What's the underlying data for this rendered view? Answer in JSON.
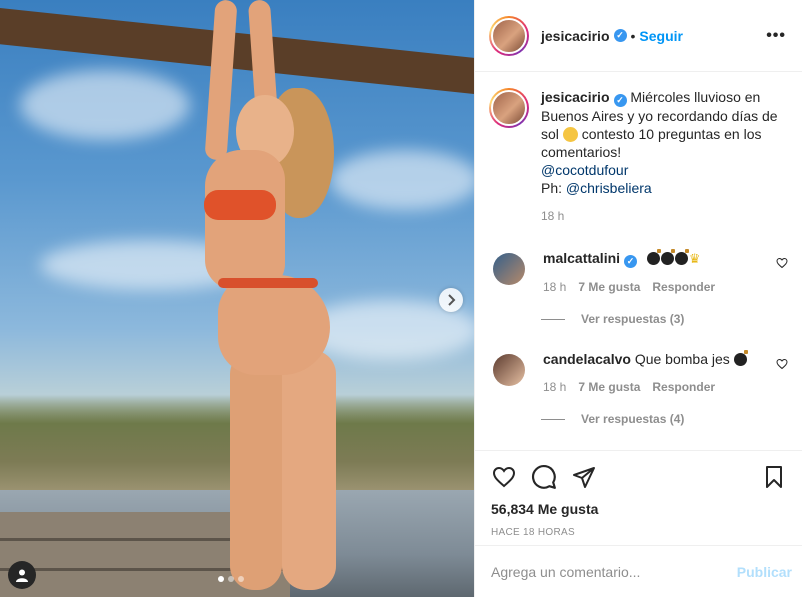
{
  "post": {
    "username": "jesicacirio",
    "follow_label": "Seguir",
    "separator": "•",
    "more_label": "•••",
    "caption": {
      "username": "jesicacirio",
      "text": "Miércoles lluvioso en Buenos Aires y yo recordando días de sol",
      "text2": "contesto 10 preguntas en los comentarios!",
      "mention1": "@cocotdufour",
      "credit_prefix": "Ph: ",
      "mention2": "@chrisbeliera",
      "time": "18 h"
    },
    "comments": [
      {
        "username": "malcattalini",
        "text": "",
        "time": "18 h",
        "likes": "7 Me gusta",
        "reply_label": "Responder",
        "view_replies": "Ver respuestas (3)"
      },
      {
        "username": "candelacalvo",
        "text": "Que bomba jes",
        "time": "18 h",
        "likes": "7 Me gusta",
        "reply_label": "Responder",
        "view_replies": "Ver respuestas (4)"
      }
    ],
    "likes_count": "56,834 Me gusta",
    "posted_ago": "HACE 18 HORAS",
    "comment_placeholder": "Agrega un comentario...",
    "publish_label": "Publicar",
    "next_icon": "chevron-right-icon",
    "carousel": {
      "total": 3,
      "active": 1
    }
  },
  "colors": {
    "accent": "#0095f6",
    "verified": "#3897f0",
    "muted": "#8e8e8e",
    "publish_disabled": "#b2dffc"
  }
}
